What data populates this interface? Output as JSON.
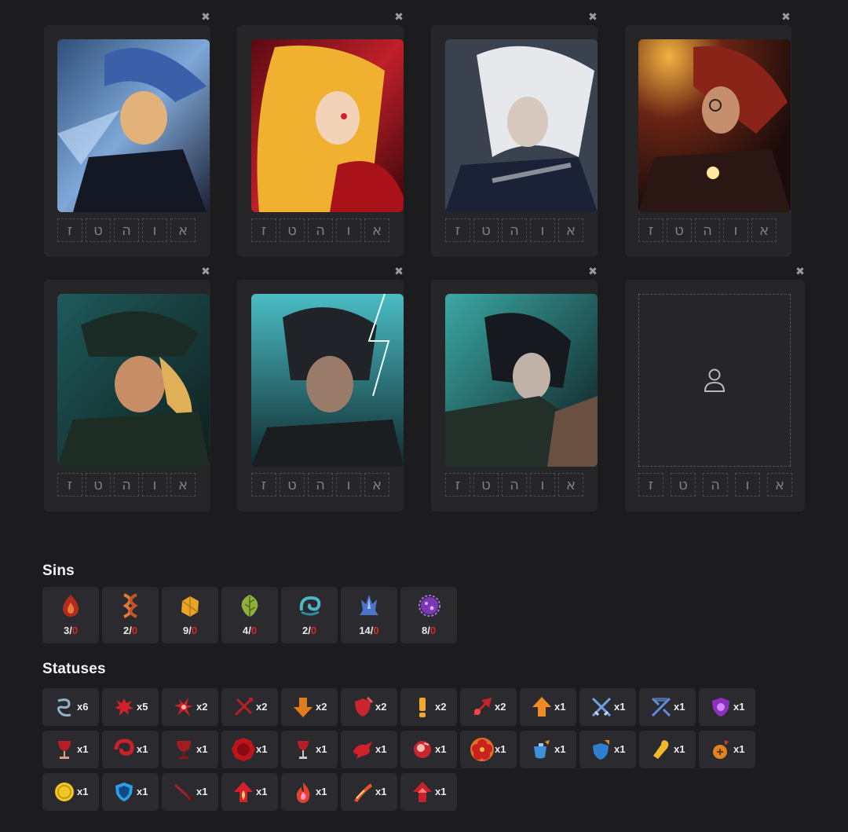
{
  "team": {
    "close_glyph": "✖",
    "letters": [
      "ז",
      "ט",
      "ה",
      "ו",
      "א"
    ],
    "slots": [
      {
        "name": "slot-1",
        "art": "blue-hat-blond",
        "empty": false
      },
      {
        "name": "slot-2",
        "art": "blonde-red",
        "empty": false
      },
      {
        "name": "slot-3",
        "art": "white-hair",
        "empty": false
      },
      {
        "name": "slot-4",
        "art": "red-glasses",
        "empty": false
      },
      {
        "name": "slot-5",
        "art": "green-officer",
        "empty": false
      },
      {
        "name": "slot-6",
        "art": "teal-lightning",
        "empty": false
      },
      {
        "name": "slot-7",
        "art": "dark-rain",
        "empty": false
      },
      {
        "name": "slot-8",
        "art": "",
        "empty": true,
        "placeholder_icon": "user-icon"
      }
    ]
  },
  "sins": {
    "title": "Sins",
    "items": [
      {
        "name": "wrath-icon",
        "count": "3",
        "cap": "0",
        "color": "#c0392b"
      },
      {
        "name": "lust-icon",
        "count": "2",
        "cap": "0",
        "color": "#e07a3a"
      },
      {
        "name": "sloth-icon",
        "count": "9",
        "cap": "0",
        "color": "#e8a527"
      },
      {
        "name": "gluttony-icon",
        "count": "4",
        "cap": "0",
        "color": "#8fb03c"
      },
      {
        "name": "gloom-icon",
        "count": "2",
        "cap": "0",
        "color": "#4fb6c9"
      },
      {
        "name": "pride-icon",
        "count": "14",
        "cap": "0",
        "color": "#4a73c9"
      },
      {
        "name": "envy-icon",
        "count": "8",
        "cap": "0",
        "color": "#8e4cc4"
      }
    ],
    "slash": "/"
  },
  "statuses": {
    "title": "Statuses",
    "items": [
      {
        "name": "tremor-swirl-icon",
        "count": "x6",
        "color": "#8fb3c9"
      },
      {
        "name": "bleed-splatter-icon",
        "count": "x5",
        "color": "#d0202a"
      },
      {
        "name": "burst-icon",
        "count": "x2",
        "color": "#d0202a"
      },
      {
        "name": "crossed-spear-icon",
        "count": "x2",
        "color": "#b81e26"
      },
      {
        "name": "down-arrow-icon",
        "count": "x2",
        "color": "#e07b1e"
      },
      {
        "name": "red-shield-icon",
        "count": "x2",
        "color": "#c92530"
      },
      {
        "name": "exclamation-icon",
        "count": "x2",
        "color": "#f0a72a"
      },
      {
        "name": "red-arrow-burst-icon",
        "count": "x2",
        "color": "#c9202a"
      },
      {
        "name": "up-arrow-icon",
        "count": "x1",
        "color": "#f08a22"
      },
      {
        "name": "blue-crossed-swords-icon",
        "count": "x1",
        "color": "#6fa0e0"
      },
      {
        "name": "broken-swords-icon",
        "count": "x1",
        "color": "#5d8fde"
      },
      {
        "name": "purple-shield-icon",
        "count": "x1",
        "color": "#8e2fc0"
      },
      {
        "name": "goblet-icon",
        "count": "x1",
        "color": "#b81e26"
      },
      {
        "name": "red-spiral-icon",
        "count": "x1",
        "color": "#c9202a"
      },
      {
        "name": "dark-goblet-icon",
        "count": "x1",
        "color": "#a31c22"
      },
      {
        "name": "red-seal-icon",
        "count": "x1",
        "color": "#c0141c"
      },
      {
        "name": "spill-goblet-icon",
        "count": "x1",
        "color": "#b81e26"
      },
      {
        "name": "red-splash-icon",
        "count": "x1",
        "color": "#d0202a"
      },
      {
        "name": "heart-bloom-icon",
        "count": "x1",
        "color": "#c92530"
      },
      {
        "name": "red-flower-icon",
        "count": "x1",
        "color": "#d8401e"
      },
      {
        "name": "blue-potion-icon",
        "count": "x1",
        "color": "#3d8fd9"
      },
      {
        "name": "blue-shield-plus-icon",
        "count": "x1",
        "color": "#2e7fd1"
      },
      {
        "name": "bullet-icon",
        "count": "x1",
        "color": "#f0b82a"
      },
      {
        "name": "orange-potion-icon",
        "count": "x1",
        "color": "#e0821e"
      },
      {
        "name": "coin-icon",
        "count": "x1",
        "color": "#f0c825"
      },
      {
        "name": "cyan-shield-icon",
        "count": "x1",
        "color": "#2d9ee8"
      },
      {
        "name": "red-blade-icon",
        "count": "x1",
        "color": "#a82226"
      },
      {
        "name": "flame-arrow-icon",
        "count": "x1",
        "color": "#d8202a"
      },
      {
        "name": "flame-icon",
        "count": "x1",
        "color": "#e8402a"
      },
      {
        "name": "fire-slash-icon",
        "count": "x1",
        "color": "#e8552a"
      },
      {
        "name": "red-up-arrow-icon",
        "count": "x1",
        "color": "#c9202a"
      }
    ]
  }
}
